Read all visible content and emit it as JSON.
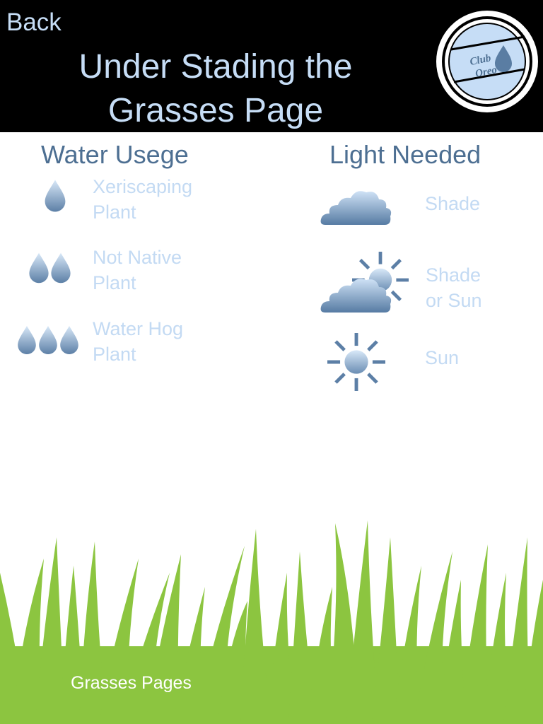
{
  "header": {
    "back_label": "Back",
    "title_line1": "Under Stading the",
    "title_line2": "Grasses Page",
    "logo_text_line1": "Club",
    "logo_text_line2": "Oreo"
  },
  "water": {
    "title": "Water Usege",
    "items": [
      {
        "label_line1": "Xeriscaping",
        "label_line2": "Plant",
        "icon": "one-drop-icon"
      },
      {
        "label_line1": "Not Native",
        "label_line2": "Plant",
        "icon": "two-drops-icon"
      },
      {
        "label_line1": "Water Hog",
        "label_line2": "Plant",
        "icon": "three-drops-icon"
      }
    ]
  },
  "light": {
    "title": "Light Needed",
    "items": [
      {
        "label_line1": "Shade",
        "label_line2": "",
        "icon": "cloud-icon"
      },
      {
        "label_line1": "Shade",
        "label_line2": "or Sun",
        "icon": "cloud-sun-icon"
      },
      {
        "label_line1": "Sun",
        "label_line2": "",
        "icon": "sun-icon"
      }
    ]
  },
  "footer": {
    "link_label": "Grasses Pages"
  },
  "colors": {
    "header_bg": "#000000",
    "header_text": "#c6ddf6",
    "section_title": "#4d6f92",
    "item_label": "#c3daf3",
    "grass": "#8cc540",
    "icon_dark": "#5a7da3",
    "icon_light": "#cfe3f7"
  }
}
